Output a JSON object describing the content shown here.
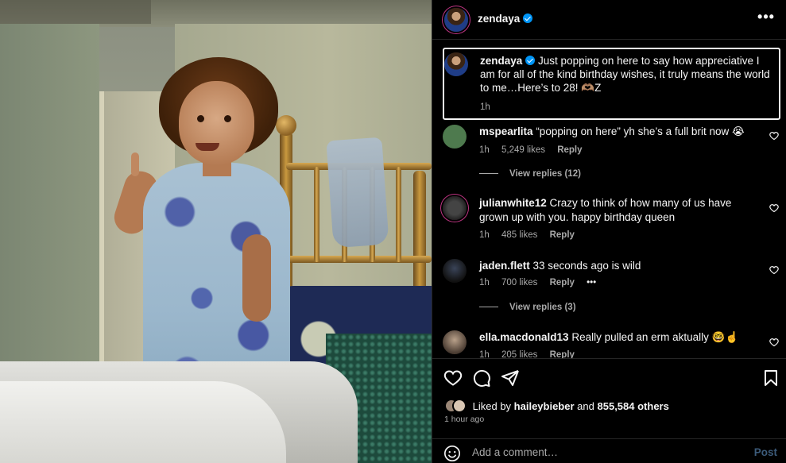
{
  "post": {
    "username": "zendaya",
    "verified": true
  },
  "caption": {
    "username": "zendaya",
    "text": "Just popping on here to say how appreciative I am for all of the kind birthday wishes, it truly means the world to me…Here’s to 28! 🫶🏽Z",
    "time": "1h"
  },
  "comments": [
    {
      "username": "mspearlita",
      "text": "“popping on here” yh she’s a full brit now 😭",
      "time": "1h",
      "likes": "5,249 likes",
      "reply": "Reply",
      "view_replies": "View replies (12)",
      "avatar_color": "#4e7a4e"
    },
    {
      "username": "julianwhite12",
      "text": "Crazy to think of how many of us have grown up with you. happy birthday queen",
      "time": "1h",
      "likes": "485 likes",
      "reply": "Reply",
      "avatar_color": "#2b2b2b"
    },
    {
      "username": "jaden.flett",
      "text": "33 seconds ago is wild",
      "time": "1h",
      "likes": "700 likes",
      "reply": "Reply",
      "more": "•••",
      "view_replies": "View replies (3)",
      "avatar_color": "#1b2230"
    },
    {
      "username": "ella.macdonald13",
      "text": "Really pulled an erm aktually 🤓☝️",
      "time": "1h",
      "likes": "205 likes",
      "reply": "Reply",
      "avatar_color": "#7a6a5a"
    }
  ],
  "engagement": {
    "liked_by_prefix": "Liked by",
    "liked_by_user": "haileybieber",
    "liked_by_suffix": "and",
    "others": "855,584 others",
    "posted": "1 hour ago"
  },
  "composer": {
    "placeholder": "Add a comment…",
    "post_label": "Post"
  },
  "icons": {
    "more": "more-options-icon",
    "like": "heart-icon",
    "comment": "comment-bubble-icon",
    "share": "paper-plane-icon",
    "save": "bookmark-icon",
    "emoji": "emoji-icon"
  },
  "colors": {
    "verified": "#0095f6",
    "post_button": "#3c5b7a",
    "caption_border": "#f5f5f5",
    "secondary_text": "#a8a8a8"
  }
}
